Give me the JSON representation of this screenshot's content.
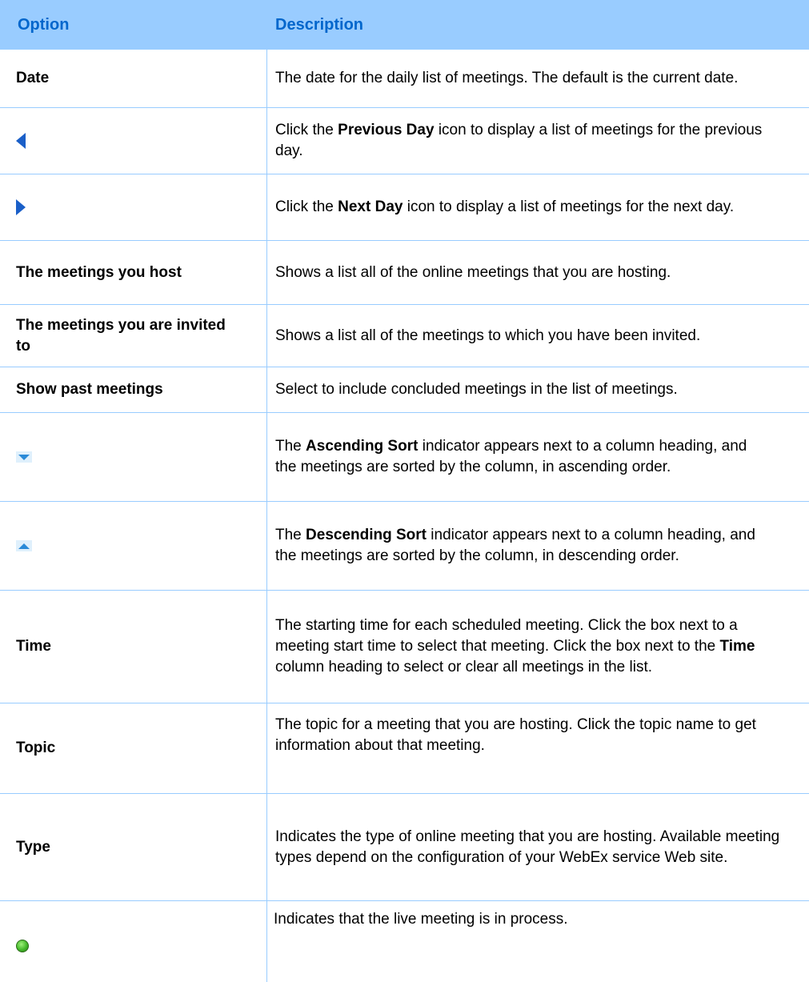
{
  "header": {
    "option": "Option",
    "description": "Description"
  },
  "rows": [
    {
      "option": "Date",
      "description": "The date for the daily list of meetings. The default is the current date."
    },
    {
      "icon": "previous-day-icon",
      "desc_pre": "Click the ",
      "desc_bold": "Previous Day",
      "desc_post": " icon to display a list of meetings for the previous day."
    },
    {
      "icon": "next-day-icon",
      "desc_pre": "Click the ",
      "desc_bold": "Next Day",
      "desc_post": " icon to display a list of meetings for the next day."
    },
    {
      "option": "The meetings you host",
      "description": "Shows a list all of the online meetings that you are hosting."
    },
    {
      "option": "The meetings you are invited to",
      "description": "Shows a list all of the meetings to which you have been invited."
    },
    {
      "option": "Show past meetings",
      "description": "Select to include concluded meetings in the list of meetings."
    },
    {
      "icon": "ascending-sort-icon",
      "desc_pre": "The ",
      "desc_bold": "Ascending Sort",
      "desc_post": " indicator appears next to a column heading, and the meetings are sorted by the column, in ascending order."
    },
    {
      "icon": "descending-sort-icon",
      "desc_pre": "The ",
      "desc_bold": "Descending Sort",
      "desc_post": " indicator appears next to a column heading, and the meetings are sorted by the column, in descending order."
    },
    {
      "option": "Time",
      "desc_pre": "The starting time for each scheduled meeting. Click the box next to a meeting start time to select that meeting. Click the box next to the ",
      "desc_bold": "Time",
      "desc_post": " column heading to select or clear all meetings in the list."
    },
    {
      "option": "Topic",
      "description": "The topic for a meeting that you are hosting. Click the topic name to get information about that meeting."
    },
    {
      "option": "Type",
      "description": "Indicates the type of online meeting that you are hosting. Available meeting types depend on the configuration of your WebEx service Web site."
    },
    {
      "icon": "live-meeting-icon",
      "description": "Indicates that the live meeting is in process."
    }
  ],
  "colors": {
    "header_bg": "#99ccff",
    "header_text": "#0066cc",
    "rule": "#99ccff"
  }
}
